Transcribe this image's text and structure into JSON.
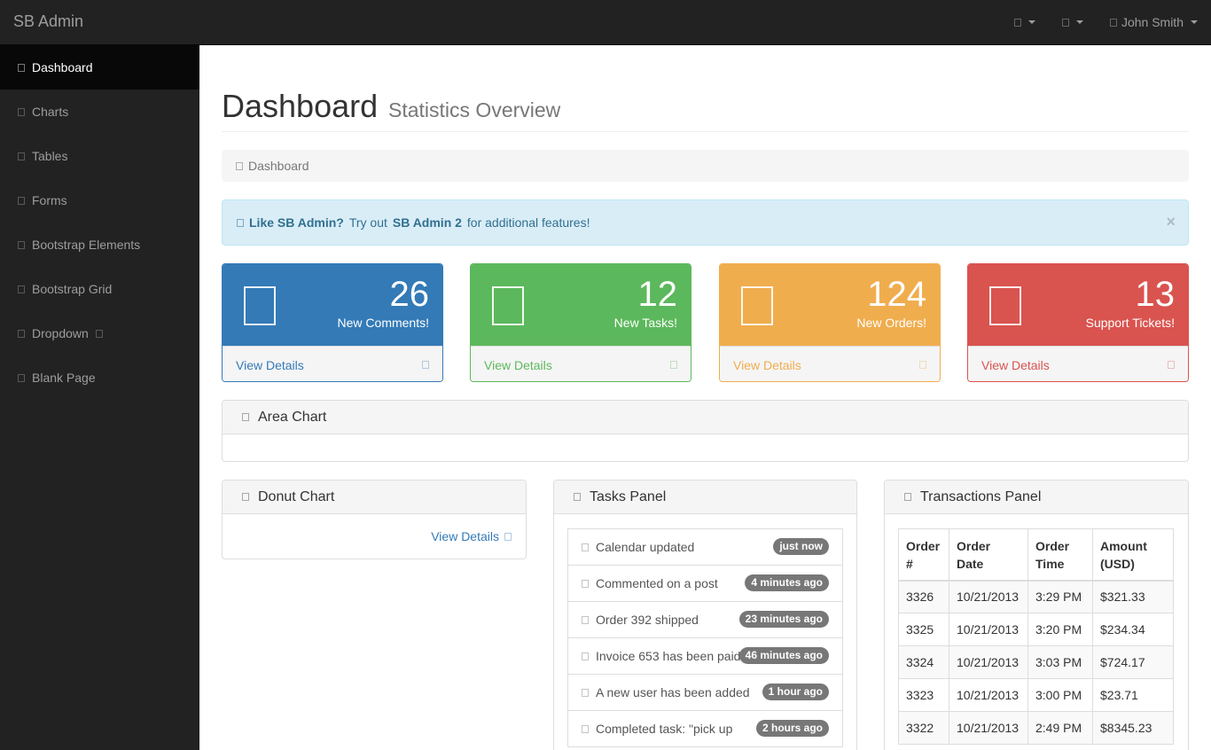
{
  "brand": "SB Admin",
  "navbar": {
    "alerts_icon": "bell-icon",
    "messages_icon": "envelope-icon",
    "user_icon": "user-icon",
    "user_name": "John Smith"
  },
  "sidebar": {
    "items": [
      {
        "label": "Dashboard",
        "icon": "dashboard-icon",
        "active": true
      },
      {
        "label": "Charts",
        "icon": "bar-chart-icon"
      },
      {
        "label": "Tables",
        "icon": "table-icon"
      },
      {
        "label": "Forms",
        "icon": "edit-icon"
      },
      {
        "label": "Bootstrap Elements",
        "icon": "desktop-icon"
      },
      {
        "label": "Bootstrap Grid",
        "icon": "wrench-icon"
      },
      {
        "label": "Dropdown",
        "icon": "arrows-icon"
      },
      {
        "label": "Blank Page",
        "icon": "file-icon"
      }
    ]
  },
  "header": {
    "title": "Dashboard",
    "subtitle": "Statistics Overview"
  },
  "breadcrumb": {
    "label": "Dashboard"
  },
  "alert": {
    "strong1": "Like SB Admin?",
    "text1": "Try out",
    "strong2": "SB Admin 2",
    "text2": "for additional features!",
    "close": "×"
  },
  "stats": [
    {
      "number": "26",
      "label": "New Comments!",
      "link": "View Details",
      "icon": "comments-icon",
      "color": "#337ab7"
    },
    {
      "number": "12",
      "label": "New Tasks!",
      "link": "View Details",
      "icon": "tasks-icon",
      "color": "#5cb85c"
    },
    {
      "number": "124",
      "label": "New Orders!",
      "link": "View Details",
      "icon": "shopping-cart-icon",
      "color": "#f0ad4e"
    },
    {
      "number": "13",
      "label": "Support Tickets!",
      "link": "View Details",
      "icon": "support-icon",
      "color": "#d9534f"
    }
  ],
  "area_chart": {
    "title": "Area Chart"
  },
  "donut_chart": {
    "title": "Donut Chart",
    "link": "View Details"
  },
  "tasks_panel": {
    "title": "Tasks Panel",
    "items": [
      {
        "text": "Calendar updated",
        "badge": "just now"
      },
      {
        "text": "Commented on a post",
        "badge": "4 minutes ago"
      },
      {
        "text": "Order 392 shipped",
        "badge": "23 minutes ago"
      },
      {
        "text": "Invoice 653 has been paid",
        "badge": "46 minutes ago"
      },
      {
        "text": "A new user has been added",
        "badge": "1 hour ago"
      },
      {
        "text": "Completed task: \"pick up",
        "badge": "2 hours ago"
      }
    ]
  },
  "transactions_panel": {
    "title": "Transactions Panel",
    "columns": [
      "Order #",
      "Order Date",
      "Order Time",
      "Amount (USD)"
    ],
    "rows": [
      [
        "3326",
        "10/21/2013",
        "3:29 PM",
        "$321.33"
      ],
      [
        "3325",
        "10/21/2013",
        "3:20 PM",
        "$234.34"
      ],
      [
        "3324",
        "10/21/2013",
        "3:03 PM",
        "$724.17"
      ],
      [
        "3323",
        "10/21/2013",
        "3:00 PM",
        "$23.71"
      ],
      [
        "3322",
        "10/21/2013",
        "2:49 PM",
        "$8345.23"
      ]
    ]
  }
}
